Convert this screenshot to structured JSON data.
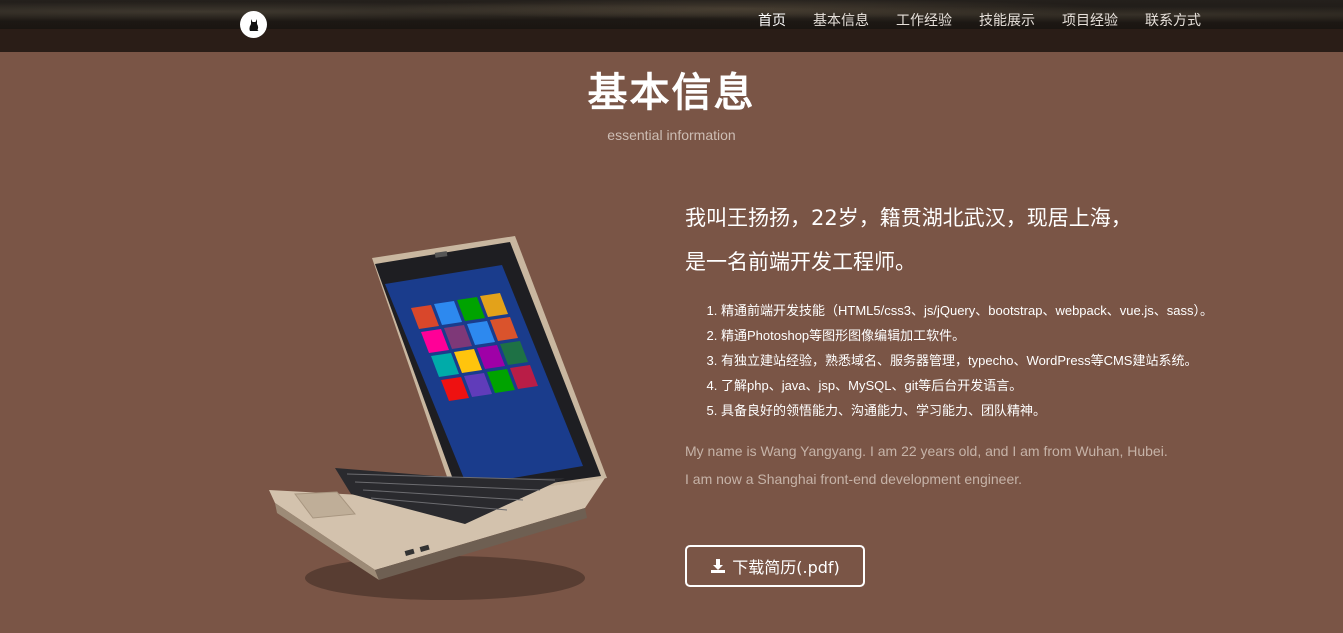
{
  "nav": {
    "logo_icon": "cat-silhouette-icon",
    "items": [
      {
        "label": "首页",
        "active": true
      },
      {
        "label": "基本信息",
        "active": false
      },
      {
        "label": "工作经验",
        "active": false
      },
      {
        "label": "技能展示",
        "active": false
      },
      {
        "label": "项目经验",
        "active": false
      },
      {
        "label": "联系方式",
        "active": false
      }
    ]
  },
  "section": {
    "title": "基本信息",
    "subtitle": "essential information"
  },
  "intro": {
    "headline_line1": "我叫王扬扬，22岁，籍贯湖北武汉，现居上海，",
    "headline_line2": "是一名前端开发工程师。",
    "skills": [
      "精通前端开发技能（HTML5/css3、js/jQuery、bootstrap、webpack、vue.js、sass）。",
      "精通Photoshop等图形图像编辑加工软件。",
      "有独立建站经验，熟悉域名、服务器管理，typecho、WordPress等CMS建站系统。",
      "了解php、java、jsp、MySQL、git等后台开发语言。",
      "具备良好的领悟能力、沟通能力、学习能力、团队精神。"
    ],
    "english_line1": "My name is Wang Yangyang. I am 22 years old, and I am from Wuhan, Hubei.",
    "english_line2": "I am now a Shanghai front-end development engineer."
  },
  "download": {
    "label": "下载简历(.pdf)",
    "icon": "download-icon"
  },
  "colors": {
    "page_bg": "#7a5546",
    "navbar_bg": "#2a1d17",
    "muted_text": "#c6b3a8"
  }
}
